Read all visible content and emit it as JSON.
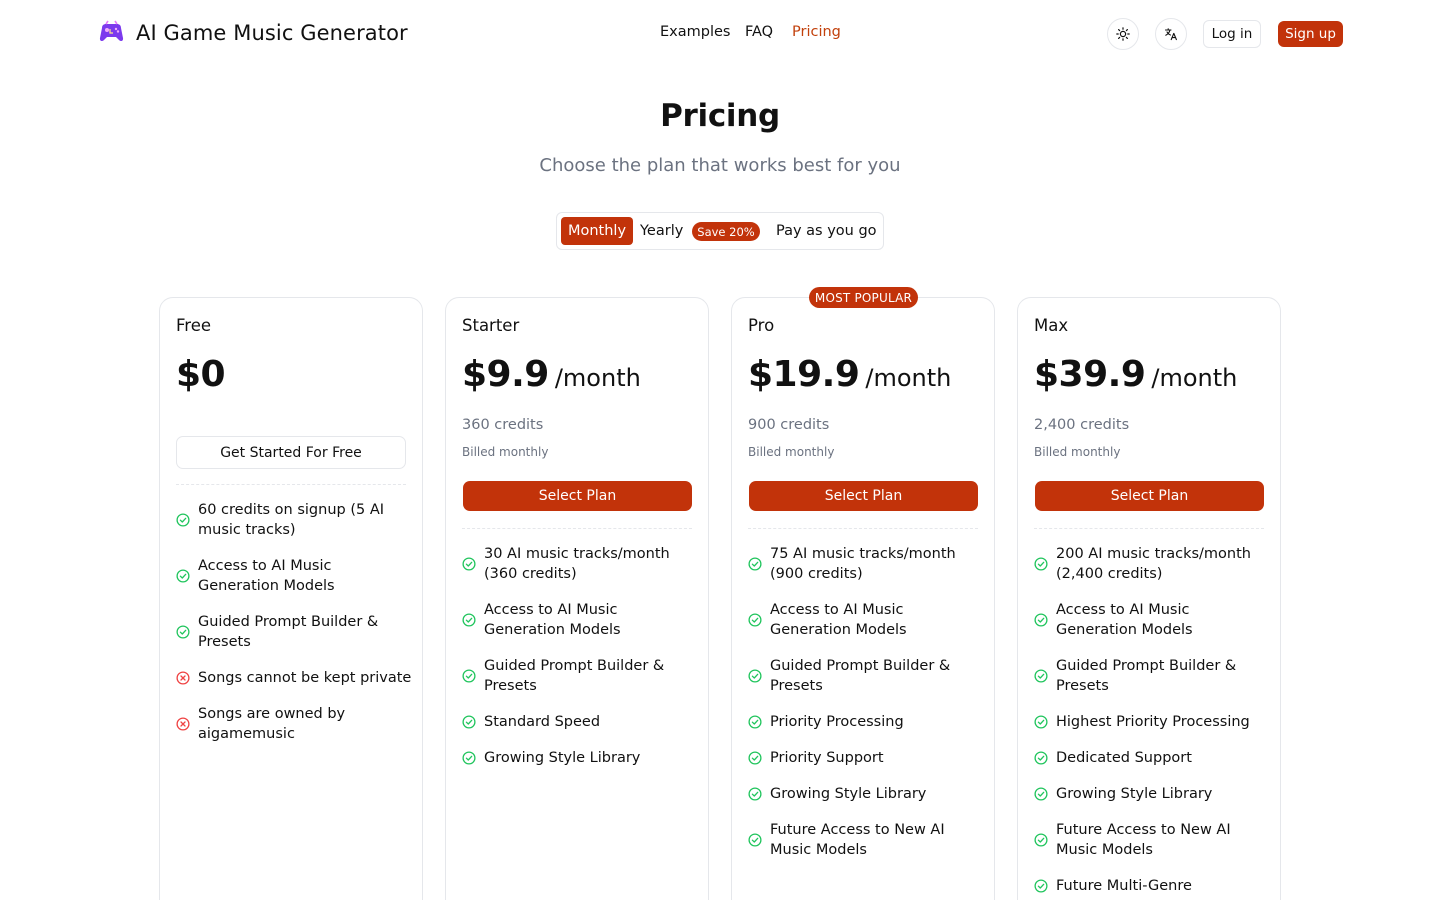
{
  "header": {
    "brand": "AI Game Music Generator",
    "nav": {
      "examples": "Examples",
      "faq": "FAQ",
      "pricing": "Pricing"
    },
    "login": "Log in",
    "signup": "Sign up"
  },
  "hero": {
    "title": "Pricing",
    "subtitle": "Choose the plan that works best for you"
  },
  "billing": {
    "monthly": "Monthly",
    "yearly": "Yearly",
    "save": "Save 20%",
    "payg": "Pay as you go",
    "selected": "Monthly"
  },
  "colors": {
    "accent": "#c2330a",
    "check": "#22c55e",
    "cross": "#ef4444"
  },
  "plans": [
    {
      "name": "Free",
      "price": "$0",
      "cta": "Get Started For Free",
      "features": [
        {
          "text": "60 credits on signup (5 AI music tracks)",
          "icon": "check-circle-icon"
        },
        {
          "text": "Access to AI Music Generation Models",
          "icon": "check-circle-icon"
        },
        {
          "text": "Guided Prompt Builder & Presets",
          "icon": "check-circle-icon"
        },
        {
          "text": "Songs cannot be kept private",
          "icon": "x-circle-icon"
        },
        {
          "text": "Songs are owned by aigamemusic",
          "icon": "x-circle-icon"
        }
      ]
    },
    {
      "name": "Starter",
      "price": "$9.9",
      "period": "/month",
      "credits": "360 credits",
      "billed": "Billed monthly",
      "cta": "Select Plan",
      "features": [
        {
          "text": "30 AI music tracks/month (360 credits)",
          "icon": "check-circle-icon"
        },
        {
          "text": "Access to AI Music Generation Models",
          "icon": "check-circle-icon"
        },
        {
          "text": "Guided Prompt Builder & Presets",
          "icon": "check-circle-icon"
        },
        {
          "text": "Standard Speed",
          "icon": "check-circle-icon"
        },
        {
          "text": "Growing Style Library",
          "icon": "check-circle-icon"
        }
      ]
    },
    {
      "name": "Pro",
      "badge": "MOST POPULAR",
      "price": "$19.9",
      "period": "/month",
      "credits": "900 credits",
      "billed": "Billed monthly",
      "cta": "Select Plan",
      "features": [
        {
          "text": "75 AI music tracks/month (900 credits)",
          "icon": "check-circle-icon"
        },
        {
          "text": "Access to AI Music Generation Models",
          "icon": "check-circle-icon"
        },
        {
          "text": "Guided Prompt Builder & Presets",
          "icon": "check-circle-icon"
        },
        {
          "text": "Priority Processing",
          "icon": "check-circle-icon"
        },
        {
          "text": "Priority Support",
          "icon": "check-circle-icon"
        },
        {
          "text": "Growing Style Library",
          "icon": "check-circle-icon"
        },
        {
          "text": "Future Access to New AI Music Models",
          "icon": "check-circle-icon"
        }
      ]
    },
    {
      "name": "Max",
      "price": "$39.9",
      "period": "/month",
      "credits": "2,400 credits",
      "billed": "Billed monthly",
      "cta": "Select Plan",
      "features": [
        {
          "text": "200 AI music tracks/month (2,400 credits)",
          "icon": "check-circle-icon"
        },
        {
          "text": "Access to AI Music Generation Models",
          "icon": "check-circle-icon"
        },
        {
          "text": "Guided Prompt Builder & Presets",
          "icon": "check-circle-icon"
        },
        {
          "text": "Highest Priority Processing",
          "icon": "check-circle-icon"
        },
        {
          "text": "Dedicated Support",
          "icon": "check-circle-icon"
        },
        {
          "text": "Growing Style Library",
          "icon": "check-circle-icon"
        },
        {
          "text": "Future Access to New AI Music Models",
          "icon": "check-circle-icon"
        },
        {
          "text": "Future Multi-Genre",
          "icon": "check-circle-icon"
        }
      ]
    }
  ]
}
